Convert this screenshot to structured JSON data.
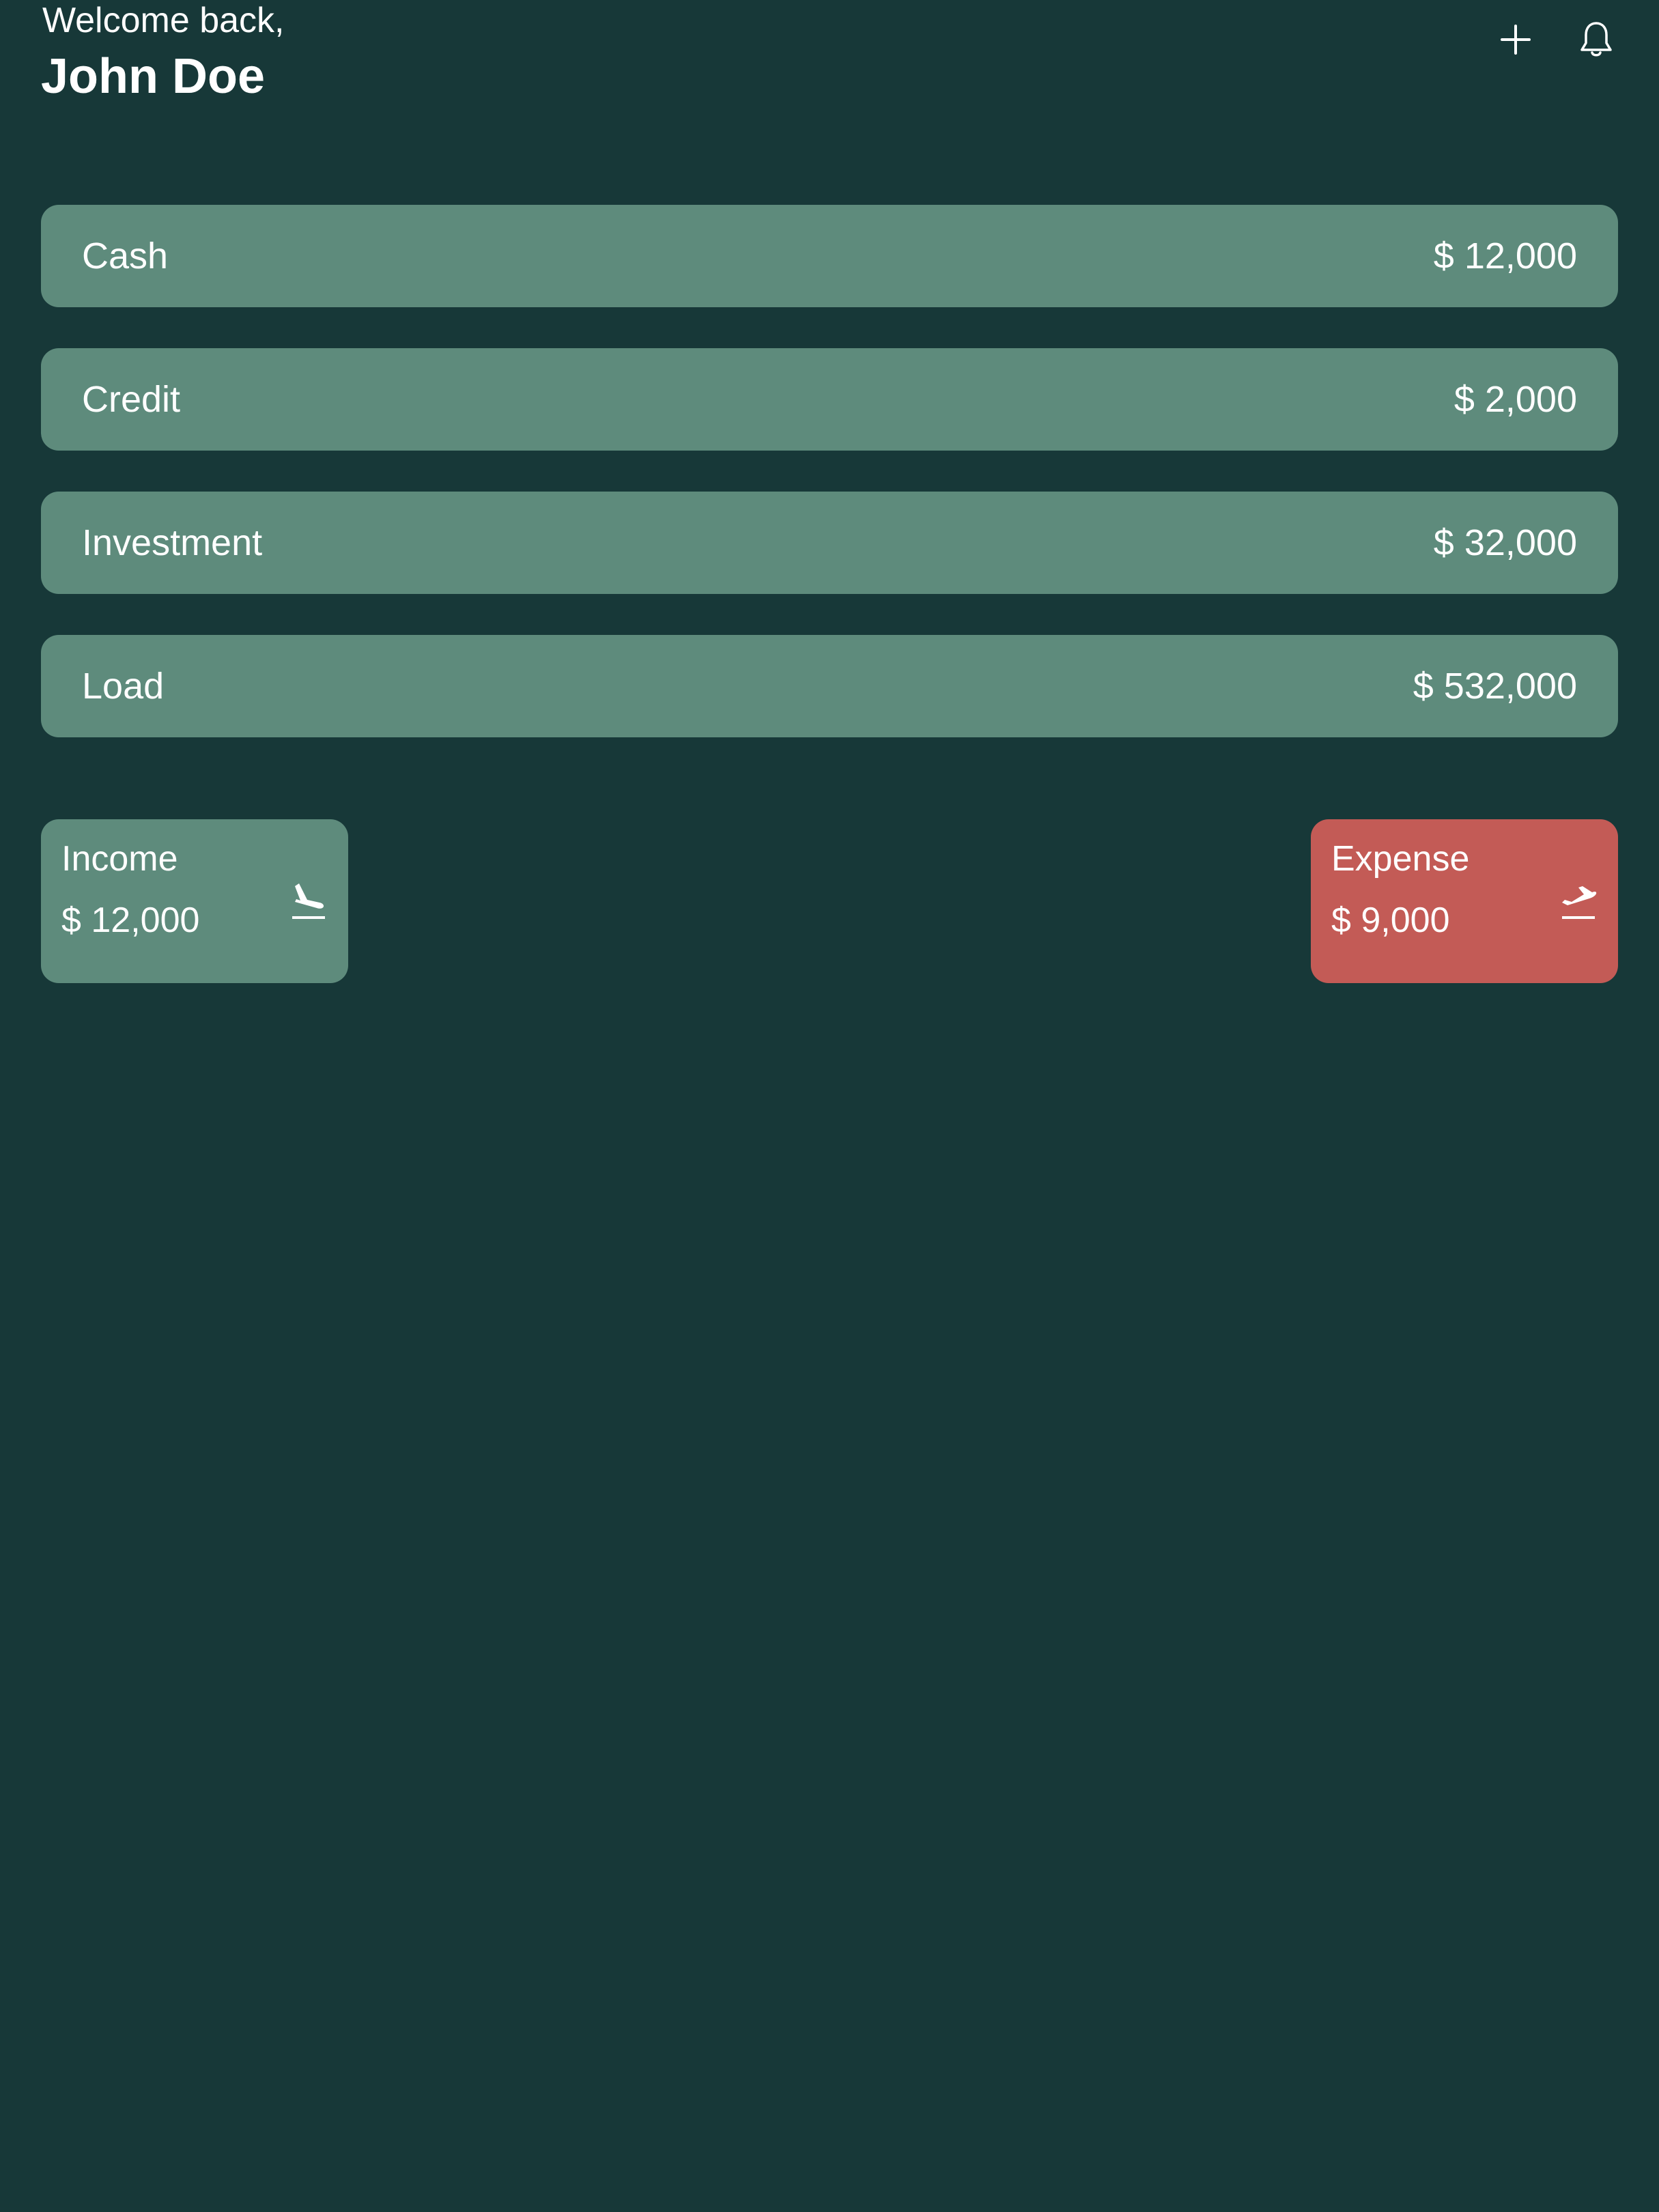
{
  "header": {
    "greeting": "Welcome back,",
    "user_name": "John Doe",
    "add_icon": "plus-icon",
    "notification_icon": "bell-icon"
  },
  "accounts": [
    {
      "label": "Cash",
      "amount": "$ 12,000"
    },
    {
      "label": "Credit",
      "amount": "$ 2,000"
    },
    {
      "label": "Investment",
      "amount": "$ 32,000"
    },
    {
      "label": "Load",
      "amount": "$ 532,000"
    }
  ],
  "summary": {
    "income": {
      "label": "Income",
      "amount": "$ 12,000",
      "icon": "flight-land-icon"
    },
    "expense": {
      "label": "Expense",
      "amount": "$ 9,000",
      "icon": "flight-takeoff-icon"
    }
  },
  "colors": {
    "background": "#173838",
    "card": "#5e8b7c",
    "expense": "#c35b56",
    "text": "#ffffff"
  }
}
